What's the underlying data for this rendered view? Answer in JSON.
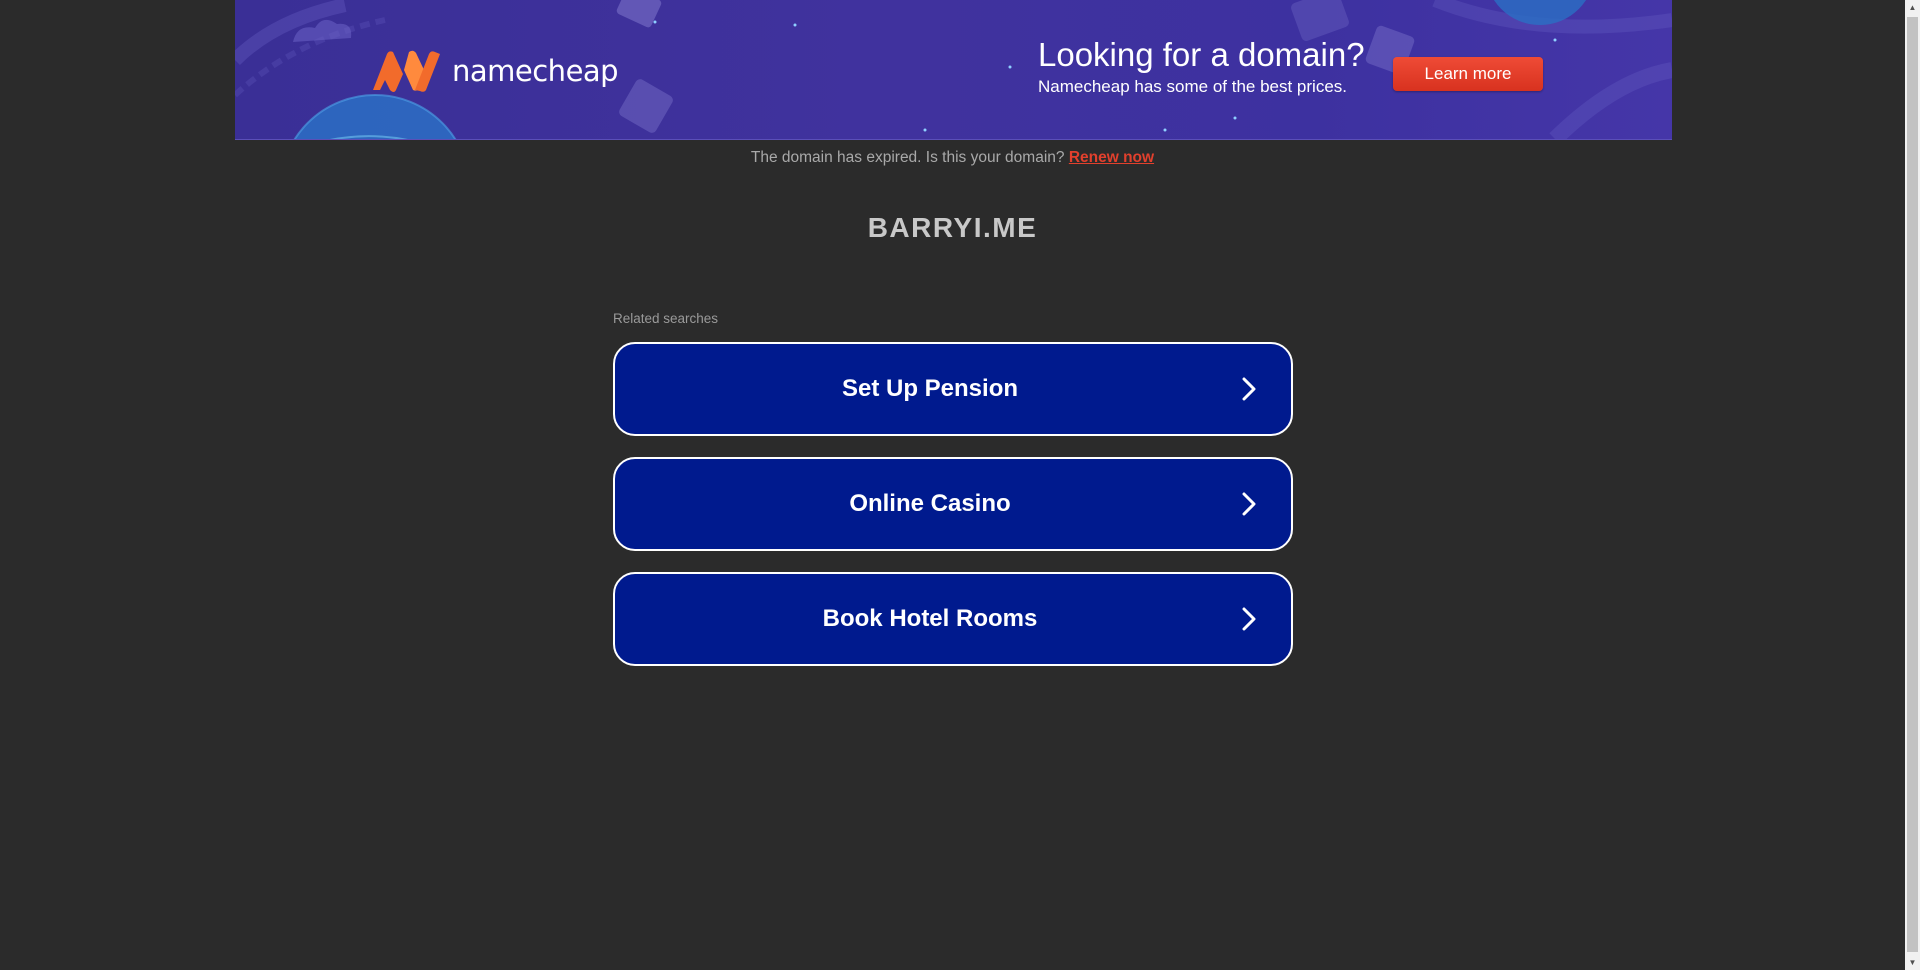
{
  "banner": {
    "brand_name": "namecheap",
    "title": "Looking for a domain?",
    "subtitle": "Namecheap has some of the best prices.",
    "cta_label": "Learn more",
    "colors": {
      "background": "#3d31a0",
      "cta": "#e2402d",
      "brand_mark": "#f26b2b"
    }
  },
  "notice": {
    "text": "The domain has expired. Is this your domain?",
    "link_label": "Renew now"
  },
  "domain": {
    "name": "BARRYI.ME"
  },
  "related": {
    "label": "Related searches",
    "items": [
      {
        "label": "Set Up Pension",
        "icon": "chevron-right-icon"
      },
      {
        "label": "Online Casino",
        "icon": "chevron-right-icon"
      },
      {
        "label": "Book Hotel Rooms",
        "icon": "chevron-right-icon"
      }
    ],
    "colors": {
      "item_background": "#001a8e",
      "item_border": "#ffffff"
    }
  },
  "page": {
    "background": "#2b2b2b"
  }
}
